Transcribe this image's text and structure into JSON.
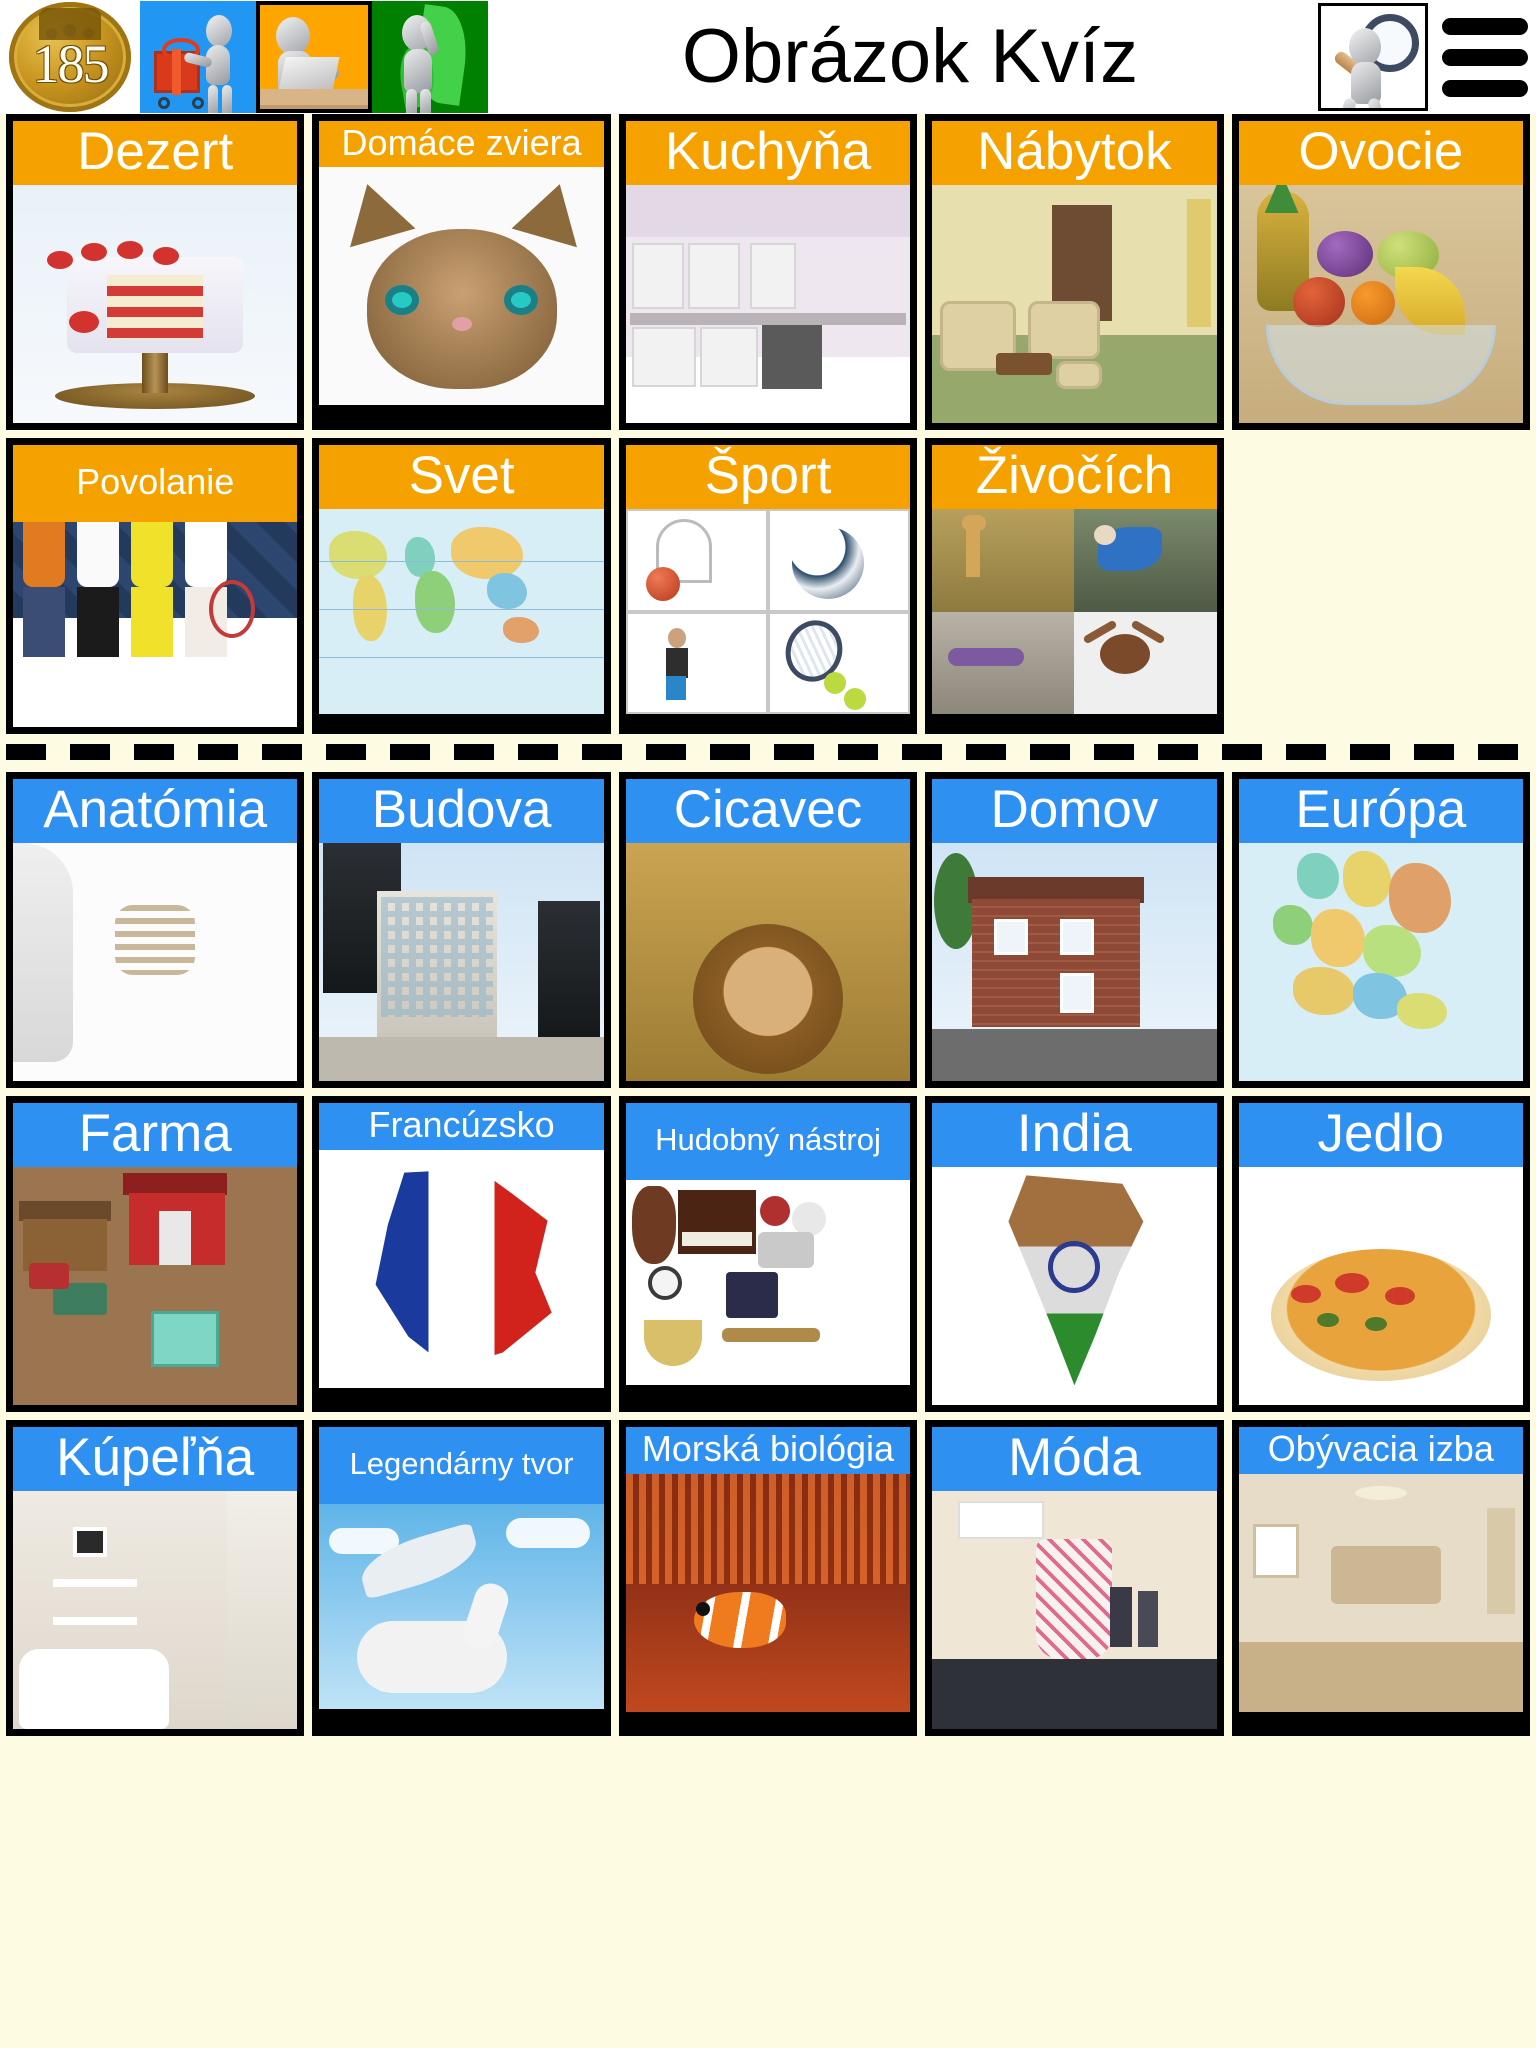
{
  "header": {
    "score": "185",
    "title": "Obrázok Kvíz",
    "icons": {
      "coin": "coin-badge-icon",
      "shop": "shopping-cart-figure-icon",
      "study": "laptop-figure-icon",
      "correct": "green-check-figure-icon",
      "search": "magnifier-figure-icon",
      "menu": "hamburger-menu-icon"
    }
  },
  "sections": [
    {
      "id": "orange",
      "accent": "#f5a200",
      "cards": [
        {
          "label": "Dezert",
          "size": "s1",
          "image": "strawberry-layer-cake-on-stand"
        },
        {
          "label": "Domáce zviera",
          "size": "s2",
          "image": "tabby-kitten-face"
        },
        {
          "label": "Kuchyňa",
          "size": "s1",
          "image": "white-fitted-kitchen"
        },
        {
          "label": "Nábytok",
          "size": "s1",
          "image": "living-room-furniture-set"
        },
        {
          "label": "Ovocie",
          "size": "s1",
          "image": "fruit-bowl-pineapple-grapes-banana"
        },
        {
          "label": "Povolanie",
          "size": "s2h",
          "image": "four-professionals-group"
        },
        {
          "label": "Svet",
          "size": "s1",
          "image": "world-political-map"
        },
        {
          "label": "Šport",
          "size": "s1",
          "image": "sports-collage-four-tiles"
        },
        {
          "label": "Živočích",
          "size": "s1",
          "image": "animals-collage-four-tiles"
        }
      ]
    },
    {
      "id": "blue",
      "accent": "#2e90f0",
      "cards": [
        {
          "label": "Anatómia",
          "size": "s1",
          "image": "human-anatomy-skeleton-figure"
        },
        {
          "label": "Budova",
          "size": "s1",
          "image": "city-office-buildings"
        },
        {
          "label": "Cicavec",
          "size": "s1",
          "image": "male-lion-in-dry-grass"
        },
        {
          "label": "Domov",
          "size": "s1",
          "image": "brick-detached-house"
        },
        {
          "label": "Európa",
          "size": "s1",
          "image": "europe-political-map"
        },
        {
          "label": "Farma",
          "size": "s1",
          "image": "farm-with-red-barn"
        },
        {
          "label": "Francúzsko",
          "size": "s2",
          "image": "france-map-flag"
        },
        {
          "label": "Hudobný nástroj",
          "size": "s3",
          "image": "musical-instruments-collection"
        },
        {
          "label": "India",
          "size": "s1",
          "image": "india-map-flag"
        },
        {
          "label": "Jedlo",
          "size": "s1",
          "image": "pizza"
        },
        {
          "label": "Kúpeľňa",
          "size": "s1",
          "image": "bathroom-interior"
        },
        {
          "label": "Legendárny tvor",
          "size": "s3",
          "image": "white-pegasus-in-sky"
        },
        {
          "label": "Morská biológia",
          "size": "s2",
          "image": "clownfish-in-anemone"
        },
        {
          "label": "Móda",
          "size": "s1",
          "image": "fashion-model-on-runway"
        },
        {
          "label": "Obývacia izba",
          "size": "s2",
          "image": "living-room-interior"
        }
      ]
    }
  ]
}
